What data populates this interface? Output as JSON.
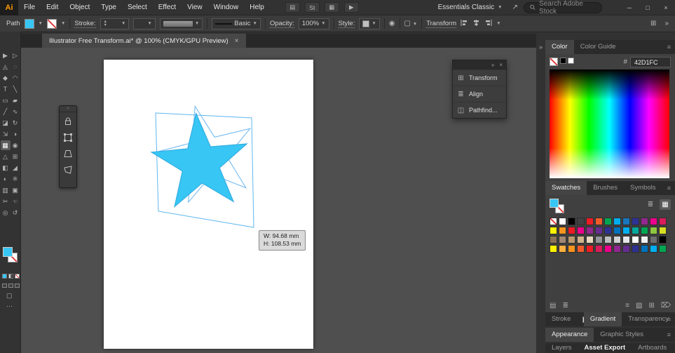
{
  "app": {
    "logo": "Ai",
    "menus": [
      "File",
      "Edit",
      "Object",
      "Type",
      "Select",
      "Effect",
      "View",
      "Window",
      "Help"
    ],
    "toolbar_icons": [
      {
        "name": "document-setup-icon",
        "glyph": "▤"
      },
      {
        "name": "adobe-stock-icon",
        "glyph": "St"
      },
      {
        "name": "arrange-documents-icon",
        "glyph": "▦"
      },
      {
        "name": "share-icon",
        "glyph": "▶"
      }
    ],
    "workspace": "Essentials Classic",
    "gpu_icon": "↗",
    "search_placeholder": "Search Adobe Stock",
    "window_controls": {
      "minimize": "─",
      "maximize": "□",
      "close": "×"
    }
  },
  "control_bar": {
    "selection_label": "Path",
    "stroke_label": "Stroke:",
    "brush_name": "Basic",
    "opacity_label": "Opacity:",
    "opacity_value": "100%",
    "style_label": "Style:",
    "transform_label": "Transform",
    "fill_color": "#38C6F4"
  },
  "document_tab": {
    "title": "Illustrator Free Transform.ai* @ 100% (CMYK/GPU Preview)",
    "close": "×"
  },
  "tools": [
    {
      "name": "selection-tool",
      "glyph": "▶"
    },
    {
      "name": "direct-selection-tool",
      "glyph": "▷"
    },
    {
      "name": "magic-wand-tool",
      "glyph": "◬"
    },
    {
      "name": "lasso-tool",
      "glyph": "◌"
    },
    {
      "name": "pen-tool",
      "glyph": "◆"
    },
    {
      "name": "curvature-tool",
      "glyph": "◠"
    },
    {
      "name": "type-tool",
      "glyph": "T"
    },
    {
      "name": "line-segment-tool",
      "glyph": "╲"
    },
    {
      "name": "rectangle-tool",
      "glyph": "▭"
    },
    {
      "name": "paintbrush-tool",
      "glyph": "▰"
    },
    {
      "name": "pencil-tool",
      "glyph": "╱"
    },
    {
      "name": "shaper-tool",
      "glyph": "∿"
    },
    {
      "name": "eraser-tool",
      "glyph": "◪"
    },
    {
      "name": "rotate-tool",
      "glyph": "↻"
    },
    {
      "name": "scale-tool",
      "glyph": "⇲"
    },
    {
      "name": "width-tool",
      "glyph": "◑"
    },
    {
      "name": "free-transform-tool",
      "glyph": "▦",
      "active": true
    },
    {
      "name": "shape-builder-tool",
      "glyph": "◉"
    },
    {
      "name": "perspective-grid-tool",
      "glyph": "△"
    },
    {
      "name": "mesh-tool",
      "glyph": "⊞"
    },
    {
      "name": "gradient-tool",
      "glyph": "◧"
    },
    {
      "name": "eyedropper-tool",
      "glyph": "◢"
    },
    {
      "name": "blend-tool",
      "glyph": "◐"
    },
    {
      "name": "symbol-sprayer-tool",
      "glyph": "※"
    },
    {
      "name": "column-graph-tool",
      "glyph": "▥"
    },
    {
      "name": "artboard-tool",
      "glyph": "▣"
    },
    {
      "name": "slice-tool",
      "glyph": "✂"
    },
    {
      "name": "hand-tool",
      "glyph": "☜"
    },
    {
      "name": "zoom-tool",
      "glyph": "◎"
    },
    {
      "name": "rotate-view-tool",
      "glyph": "↺"
    }
  ],
  "canvas": {
    "tooltip": {
      "width": "W: 94.68 mm",
      "height": "H: 108.53 mm"
    },
    "star_fill": "#38C6F4",
    "selection_color": "#5FB7F0"
  },
  "free_transform_widget": {
    "buttons": [
      "constrain",
      "free-transform",
      "perspective-distort",
      "free-distort"
    ]
  },
  "floating_panel": {
    "collapse_icon": "»",
    "close_icon": "×",
    "items": [
      {
        "label": "Transform",
        "glyph": "⊞"
      },
      {
        "label": "Align",
        "glyph": "≣"
      },
      {
        "label": "Pathfind...",
        "glyph": "◫"
      }
    ]
  },
  "dock": {
    "collapse_icon": "»",
    "color": {
      "tabs": [
        "Color",
        "Color Guide"
      ],
      "active": "Color",
      "hex_label": "#",
      "hex_value": "42D1FC"
    },
    "swatches": {
      "tabs": [
        "Swatches",
        "Brushes",
        "Symbols"
      ],
      "active": "Swatches",
      "grid": [
        [
          "none",
          "#FFFFFF",
          "#000000",
          "#414042",
          "#ED1C24",
          "#F15A29",
          "#00A651",
          "#00AEEF",
          "#1B75BC",
          "#2E3192",
          "#92278F",
          "#EC008C",
          "#DA1C5C"
        ],
        [
          "#FFF200",
          "#F7941D",
          "#ED1C24",
          "#EC008C",
          "#92278F",
          "#662D91",
          "#2E3192",
          "#0072BC",
          "#00AEEF",
          "#00A99D",
          "#00A651",
          "#8DC63F",
          "#D7DF23"
        ],
        [
          "#8B7355",
          "#A08875",
          "#BC9A6C",
          "#D2B48C",
          "#E8D9C0",
          "#939598",
          "#BCBEC0",
          "#D1D3D4",
          "#E6E7E8",
          "#FFFFFF",
          "#F1F2F2",
          "#6D6E71",
          "#000000"
        ],
        [
          "#FFF200",
          "#FBB040",
          "#F7941D",
          "#F15A29",
          "#ED1C24",
          "#DA1C5C",
          "#EC008C",
          "#92278F",
          "#662D91",
          "#2E3192",
          "#0072BC",
          "#00AEEF",
          "#00A651"
        ]
      ],
      "buttons": [
        {
          "name": "swatch-libraries-icon",
          "glyph": "▤"
        },
        {
          "name": "swatch-kinds-icon",
          "glyph": "≣"
        },
        {
          "name": "swatch-options-icon",
          "glyph": "≡"
        },
        {
          "name": "new-color-group-icon",
          "glyph": "▧"
        },
        {
          "name": "new-swatch-icon",
          "glyph": "⊞"
        },
        {
          "name": "delete-swatch-icon",
          "glyph": "⌦"
        }
      ]
    },
    "stroke_gradient": {
      "tabs": [
        "Stroke",
        "Gradient",
        "Transparency"
      ],
      "active": "Gradient"
    },
    "appearance": {
      "tabs": [
        "Appearance",
        "Graphic Styles"
      ],
      "active": "Appearance"
    },
    "bottom": {
      "tabs": [
        "Layers",
        "Asset Export",
        "Artboards"
      ],
      "active": "Asset Export"
    }
  }
}
